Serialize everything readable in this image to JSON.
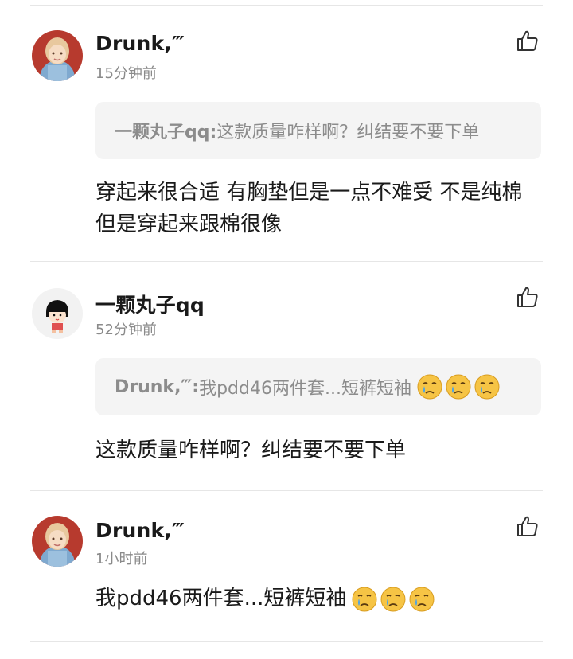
{
  "comments": [
    {
      "user": "Drunk、、",
      "display_user": "Drunk,‴",
      "time": "15分钟前",
      "quote_author": "一颗丸子qq:",
      "quote_text": " 这款质量咋样啊？纠结要不要下单",
      "text": "穿起来很合适 有胸垫但是一点不难受 不是纯棉但是穿起来跟棉很像",
      "avatar_icon": "girl-avatar-icon",
      "like_icon": "thumbs-up-icon"
    },
    {
      "display_user": "一颗丸子qq",
      "time": "52分钟前",
      "quote_author": "Drunk,‴:",
      "quote_text": " 我pdd46两件套...短裤短袖",
      "text": "这款质量咋样啊？纠结要不要下单",
      "avatar_icon": "cartoon-girl-avatar-icon",
      "like_icon": "thumbs-up-icon"
    },
    {
      "display_user": "Drunk,‴",
      "time": "1小时前",
      "text": "我pdd46两件套...短裤短袖",
      "avatar_icon": "girl-avatar-icon",
      "like_icon": "thumbs-up-icon"
    }
  ],
  "emoji_name": "crying-face-icon",
  "colors": {
    "username": "#1a1a1a",
    "timestamp": "#8a8a8a",
    "quote_bg": "#f4f4f4",
    "quote_text": "#8c8c8c",
    "divider": "#e6e6e6"
  }
}
